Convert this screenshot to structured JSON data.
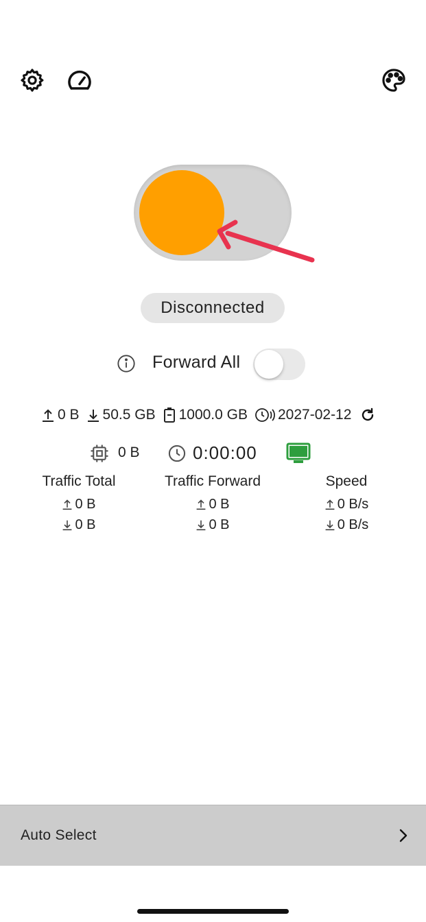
{
  "toolbar": {
    "settings_icon": "gear-icon",
    "speed_icon": "speedometer-icon",
    "theme_icon": "palette-icon"
  },
  "connection": {
    "toggle_on": false,
    "knob_color": "#ff9f00",
    "status": "Disconnected"
  },
  "forward": {
    "label": "Forward All",
    "enabled": false
  },
  "stats": {
    "upload": "0 B",
    "download": "50.5 GB",
    "quota": "1000.0 GB",
    "expiry": "2027-02-12",
    "memory": "0 B",
    "elapsed": "0:00:00",
    "monitor_color": "#2e9e3e"
  },
  "traffic": {
    "total": {
      "title": "Traffic Total",
      "up": "0 B",
      "down": "0 B"
    },
    "forward": {
      "title": "Traffic Forward",
      "up": "0 B",
      "down": "0 B"
    },
    "speed": {
      "title": "Speed",
      "up": "0 B/s",
      "down": "0 B/s"
    }
  },
  "server": {
    "label": "Auto Select"
  }
}
